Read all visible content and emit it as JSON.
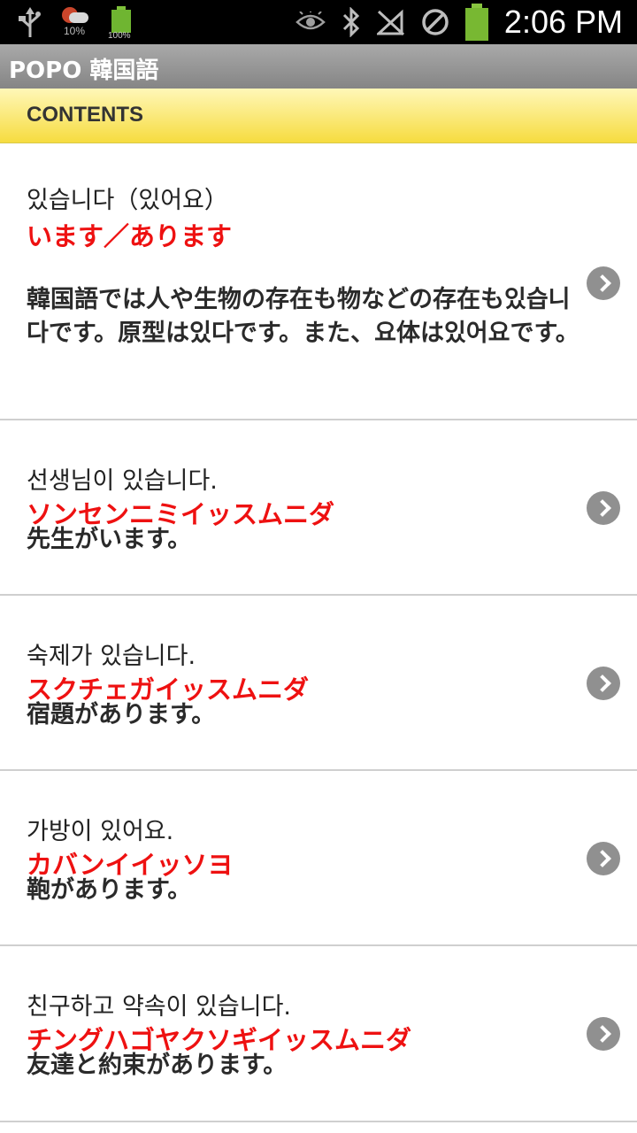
{
  "status_bar": {
    "icons_left": [
      "usb-icon",
      "weather-icon",
      "battery-widget-icon"
    ],
    "weather_percent": "10%",
    "battery_widget_label": "100%",
    "icons_right": [
      "eye-icon",
      "bluetooth-icon",
      "signal-muted-icon",
      "no-sim-icon",
      "battery-icon"
    ],
    "time": "2:06 PM"
  },
  "app": {
    "title": "POPO 韓国語"
  },
  "section": {
    "title": "CONTENTS"
  },
  "items": [
    {
      "korean": "있습니다（있어요）",
      "reading": "います／あります",
      "meaning": "韓国語では人や生物の存在も物などの存在も있습니다です。原型は있다です。また、요体は있어요です。"
    },
    {
      "korean": "선생님이 있습니다.",
      "reading": "ソンセンニミイッスムニダ",
      "meaning": "先生がいます。"
    },
    {
      "korean": "숙제가 있습니다.",
      "reading": "スクチェガイッスムニダ",
      "meaning": "宿題があります。"
    },
    {
      "korean": "가방이 있어요.",
      "reading": "カバンイイッソヨ",
      "meaning": "鞄があります。"
    },
    {
      "korean": "친구하고 약속이 있습니다.",
      "reading": "チングハゴヤクソギイッスムニダ",
      "meaning": "友達と約束があります。"
    }
  ],
  "colors": {
    "reading_text": "#ee1111",
    "header_gradient_top": "#fff7b8",
    "header_gradient_bottom": "#f6dc3f",
    "titlebar": "#999999",
    "chevron": "#909090"
  }
}
